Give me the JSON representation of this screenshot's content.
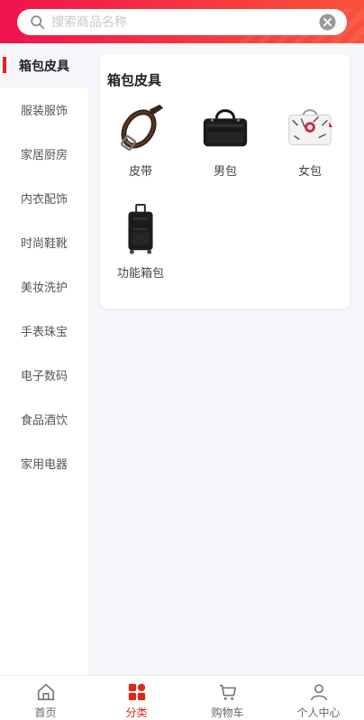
{
  "search": {
    "placeholder": "搜索商品名称"
  },
  "sidebar": {
    "items": [
      {
        "label": "箱包皮具",
        "active": true
      },
      {
        "label": "服装服饰"
      },
      {
        "label": "家居厨房"
      },
      {
        "label": "内衣配饰"
      },
      {
        "label": "时尚鞋靴"
      },
      {
        "label": "美妆洗护"
      },
      {
        "label": "手表珠宝"
      },
      {
        "label": "电子数码"
      },
      {
        "label": "食品酒饮"
      },
      {
        "label": "家用电器"
      }
    ]
  },
  "category": {
    "title": "箱包皮具",
    "products": [
      {
        "label": "皮带",
        "icon": "belt-icon"
      },
      {
        "label": "男包",
        "icon": "mens-bag-icon"
      },
      {
        "label": "女包",
        "icon": "womens-bag-icon"
      },
      {
        "label": "功能箱包",
        "icon": "luggage-icon"
      }
    ]
  },
  "tabbar": {
    "tabs": [
      {
        "label": "首页",
        "icon": "home-icon"
      },
      {
        "label": "分类",
        "icon": "category-icon",
        "active": true
      },
      {
        "label": "购物车",
        "icon": "cart-icon"
      },
      {
        "label": "个人中心",
        "icon": "user-icon"
      }
    ]
  },
  "colors": {
    "accent": "#e1251b",
    "header_start": "#f0134d",
    "header_end": "#f8523b"
  }
}
